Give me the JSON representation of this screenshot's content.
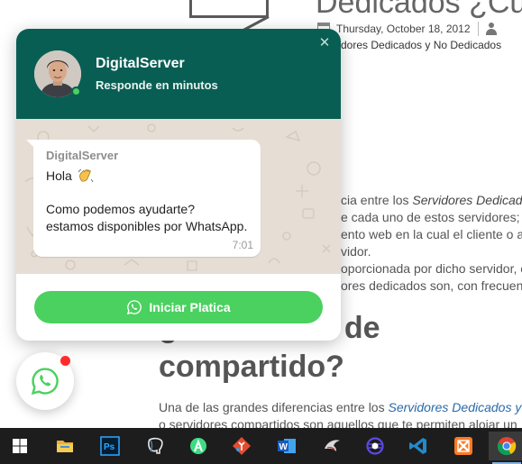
{
  "article": {
    "title": "Dedicados ¿Cuál",
    "date": "Thursday, October 18, 2012",
    "category": "dores Dedicados y No Dedicados",
    "paragraph_lines": [
      {
        "pre": "cia entre los ",
        "em": "Servidores Dedicado",
        "post": ""
      },
      {
        "pre": "e cada uno de estos servidores; c",
        "em": "",
        "post": ""
      },
      {
        "pre": "ento web en la cual el cliente o al",
        "em": "",
        "post": ""
      },
      {
        "pre": "vidor.",
        "em": "",
        "post": ""
      },
      {
        "pre": "oporcionada por dicho servidor, e",
        "em": "",
        "post": ""
      },
      {
        "pre": "ores dedicados son, con frecuen",
        "em": "",
        "post": ""
      }
    ],
    "heading_line1": "¿ ervidor no de",
    "heading_line2": "compartido?",
    "bottom_line1_pre": "Una de las grandes diferencias entre los ",
    "bottom_line1_em": "Servidores Dedicados y N",
    "bottom_line2": "o servidores compartidos son aquellos que te permiten alojar un"
  },
  "chat_widget": {
    "contact_name": "DigitalServer",
    "status": "Responde en minutos",
    "close_symbol": "✕",
    "message": {
      "sender": "DigitalServer",
      "greeting": "Hola",
      "line1": "Como podemos ayudarte?",
      "line2": "estamos disponibles por WhatsApp.",
      "time": "7:01"
    },
    "button_label": "Iniciar Platica",
    "accent_color": "#095e54",
    "button_color": "#4ad15f"
  },
  "launcher": {
    "icon": "whatsapp-icon",
    "has_notification": true
  },
  "taskbar": {
    "items": [
      {
        "name": "windows-start",
        "icon": "windows-logo-icon"
      },
      {
        "name": "file-explorer",
        "icon": "folder-icon"
      },
      {
        "name": "photoshop",
        "icon": "photoshop-icon"
      },
      {
        "name": "postgresql",
        "icon": "elephant-icon"
      },
      {
        "name": "android-studio",
        "icon": "android-studio-icon"
      },
      {
        "name": "sourcetree",
        "icon": "git-diamond-icon"
      },
      {
        "name": "word",
        "icon": "word-icon"
      },
      {
        "name": "mysql-workbench",
        "icon": "dolphin-icon"
      },
      {
        "name": "eclipse",
        "icon": "eclipse-icon"
      },
      {
        "name": "vscode",
        "icon": "vscode-icon"
      },
      {
        "name": "xampp",
        "icon": "xampp-icon"
      },
      {
        "name": "chrome",
        "icon": "chrome-icon",
        "active": true
      }
    ]
  }
}
